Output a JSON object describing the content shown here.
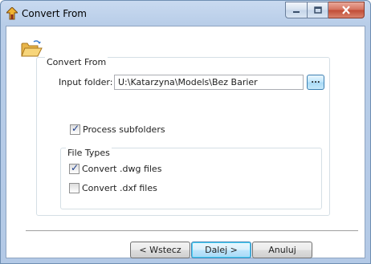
{
  "window": {
    "title": "Convert From",
    "icon": "home-arrow-icon",
    "controls": [
      "minimize-icon",
      "maximize-icon",
      "close-icon"
    ]
  },
  "header_icon": "open-folder-icon",
  "convert_from": {
    "group_label": "Convert From",
    "input_folder_label": "Input folder:",
    "input_folder_value": "U:\\Katarzyna\\Models\\Bez Barier",
    "browse_label": "...",
    "process_subfolders": {
      "label": "Process subfolders",
      "checked": true
    }
  },
  "file_types": {
    "group_label": "File Types",
    "items": [
      {
        "label": "Convert .dwg files",
        "checked": true
      },
      {
        "label": "Convert .dxf files",
        "checked": false
      }
    ]
  },
  "buttons": {
    "back": "< Wstecz",
    "next": "Dalej >",
    "cancel": "Anuluj"
  },
  "colors": {
    "frame": "#b8cde8",
    "default_button": "#bee6fd",
    "close_button": "#c04b34"
  }
}
